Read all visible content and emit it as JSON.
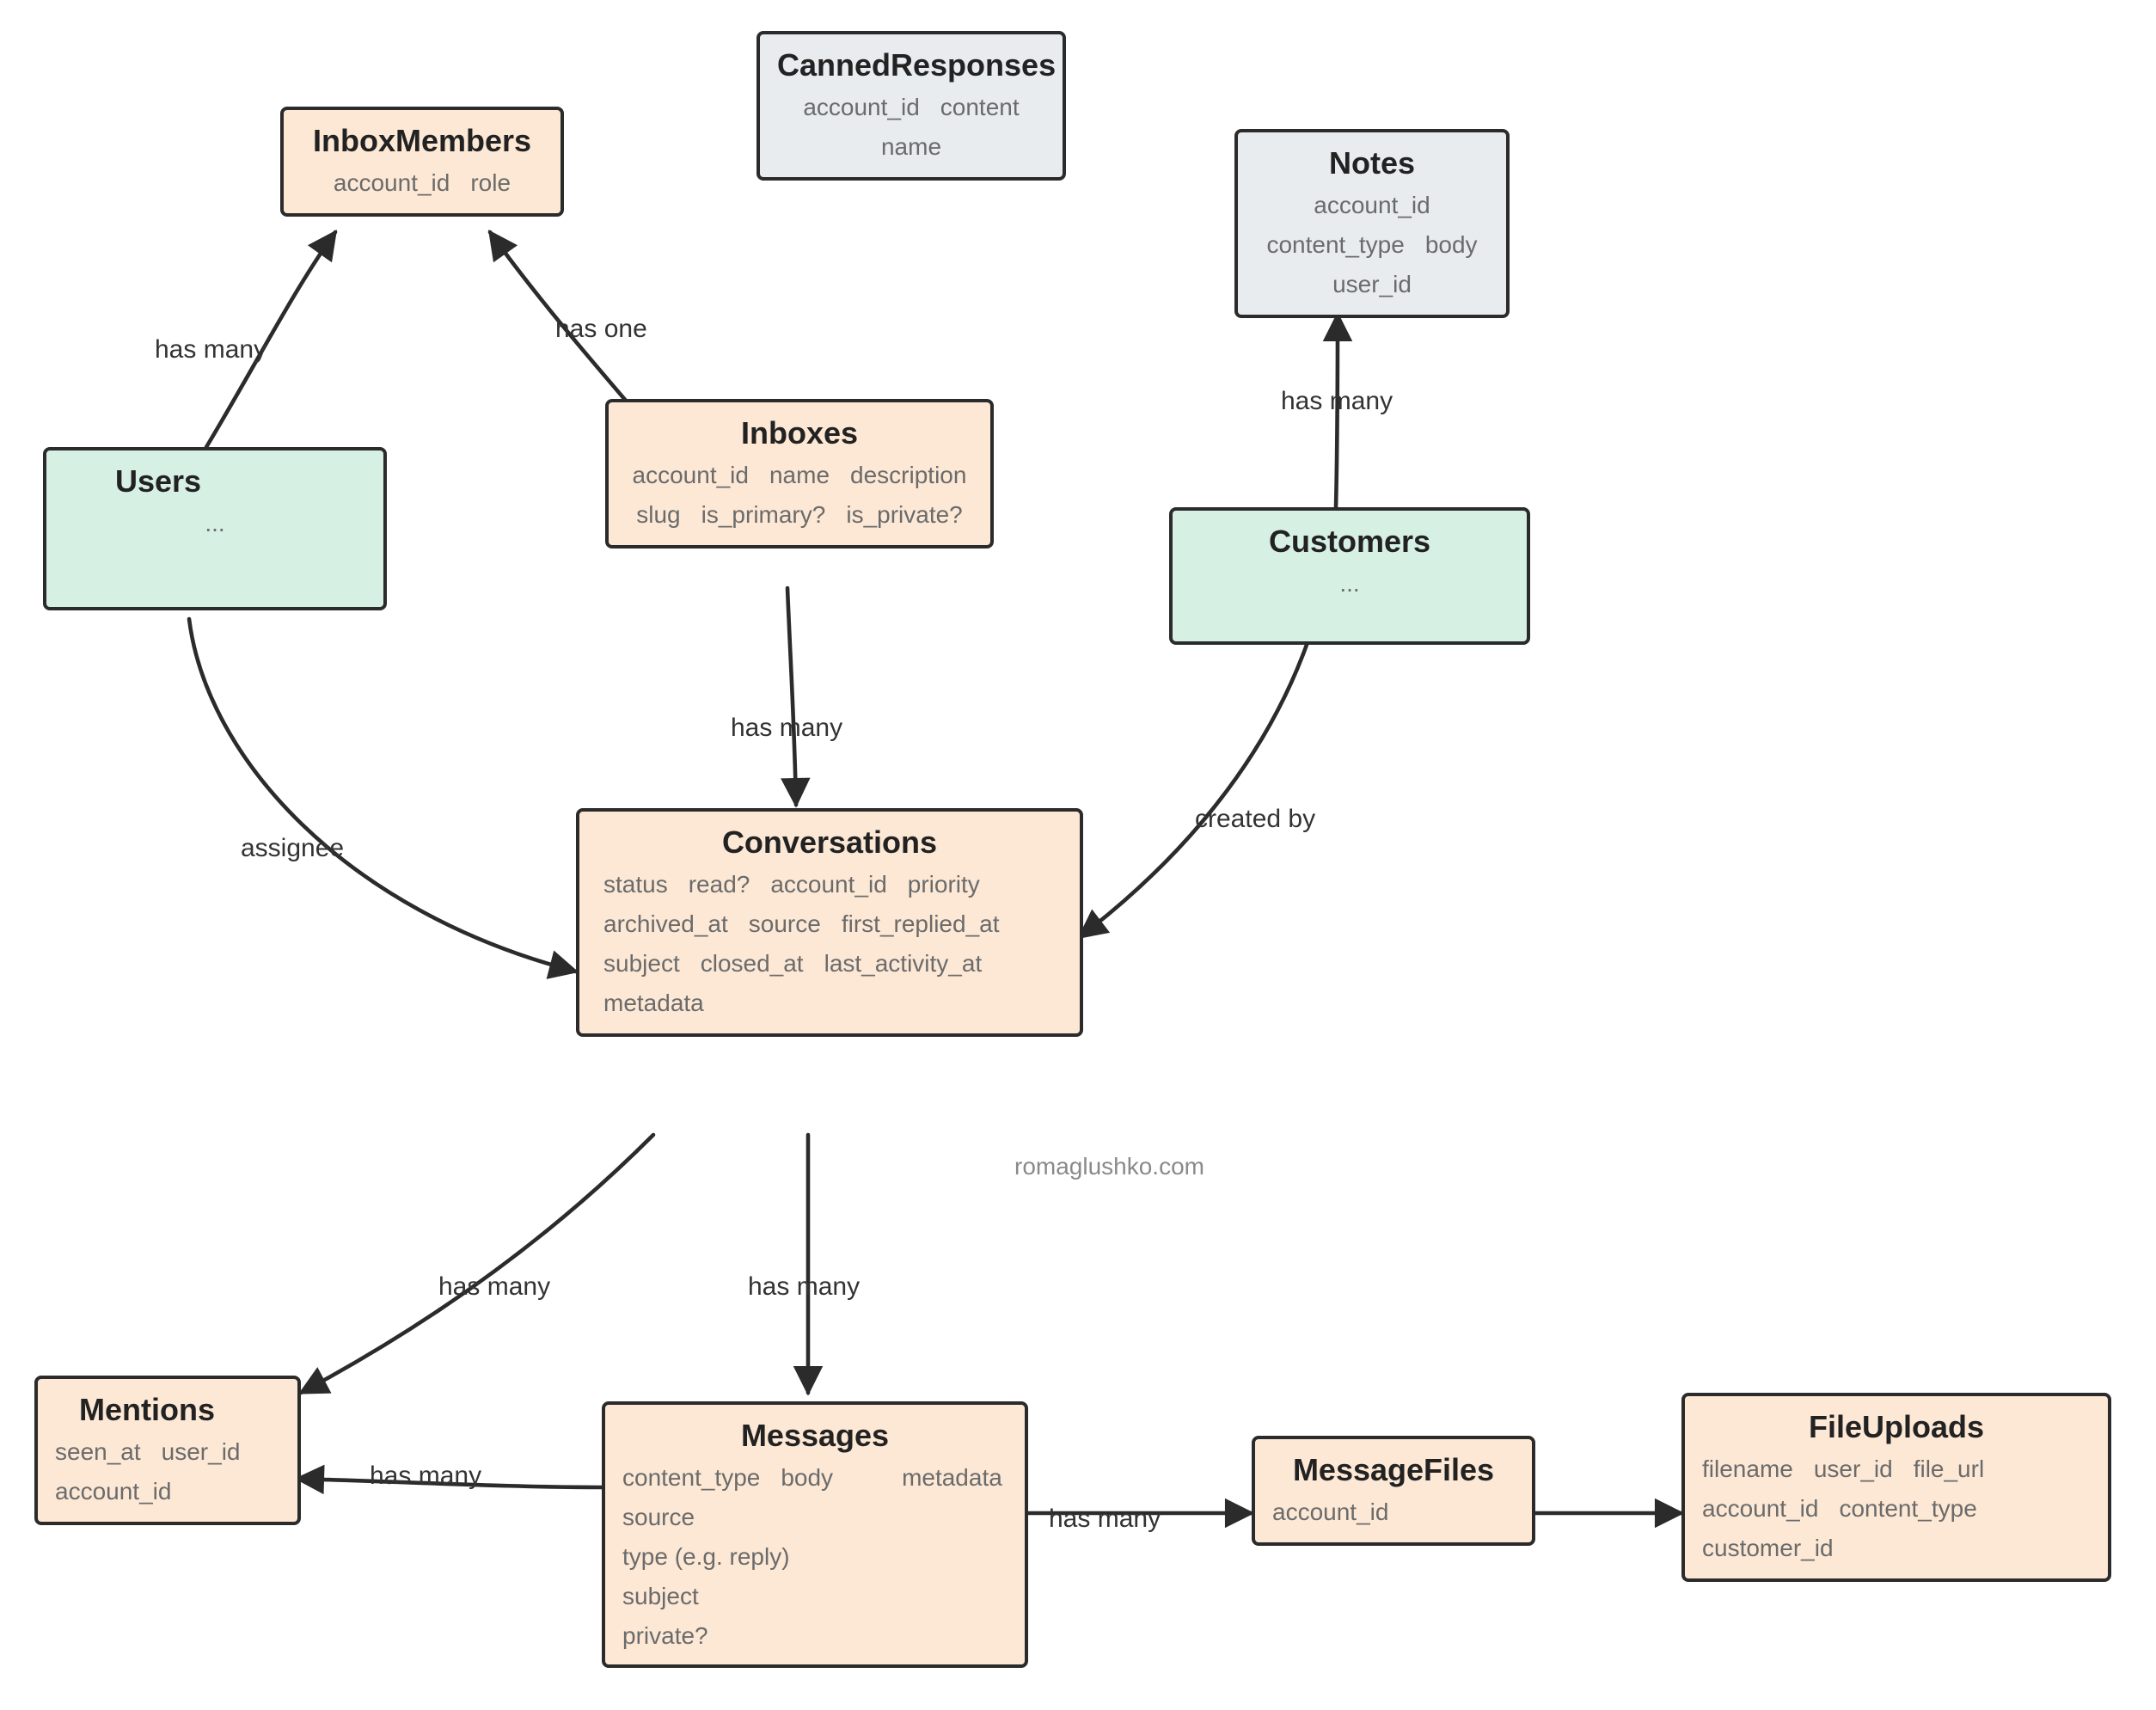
{
  "watermark": "romaglushko.com",
  "entities": {
    "cannedResponses": {
      "name": "CannedResponses",
      "attrs": [
        "account_id",
        "content",
        "name"
      ]
    },
    "inboxMembers": {
      "name": "InboxMembers",
      "attrs": [
        "account_id",
        "role"
      ]
    },
    "notes": {
      "name": "Notes",
      "attrs": [
        "account_id",
        "content_type",
        "body",
        "user_id"
      ]
    },
    "users": {
      "name": "Users",
      "attrs": [
        "..."
      ]
    },
    "inboxes": {
      "name": "Inboxes",
      "attrs": [
        "account_id",
        "name",
        "description",
        "slug",
        "is_primary?",
        "is_private?"
      ]
    },
    "customers": {
      "name": "Customers",
      "attrs": [
        "..."
      ]
    },
    "conversations": {
      "name": "Conversations",
      "attrs": [
        "status",
        "read?",
        "account_id",
        "priority",
        "archived_at",
        "source",
        "first_replied_at",
        "subject",
        "closed_at",
        "last_activity_at",
        "metadata"
      ]
    },
    "mentions": {
      "name": "Mentions",
      "attrs": [
        "seen_at",
        "user_id",
        "account_id"
      ]
    },
    "messages": {
      "name": "Messages",
      "attrs": [
        "content_type",
        "body",
        "metadata",
        "source",
        "type (e.g. reply)",
        "subject",
        "private?"
      ]
    },
    "messageFiles": {
      "name": "MessageFiles",
      "attrs": [
        "account_id"
      ]
    },
    "fileUploads": {
      "name": "FileUploads",
      "attrs": [
        "filename",
        "user_id",
        "file_url",
        "account_id",
        "content_type",
        "customer_id"
      ]
    }
  },
  "edges": {
    "users_inboxMembers": "has many",
    "inboxes_inboxMembers": "has one",
    "inboxes_conversations": "has many",
    "customers_notes": "has many",
    "users_conversations": "assignee",
    "customers_conversations": "created by",
    "conversations_mentions": "has many",
    "conversations_messages": "has many",
    "messages_mentions": "has many",
    "messages_messageFiles": "has many"
  }
}
